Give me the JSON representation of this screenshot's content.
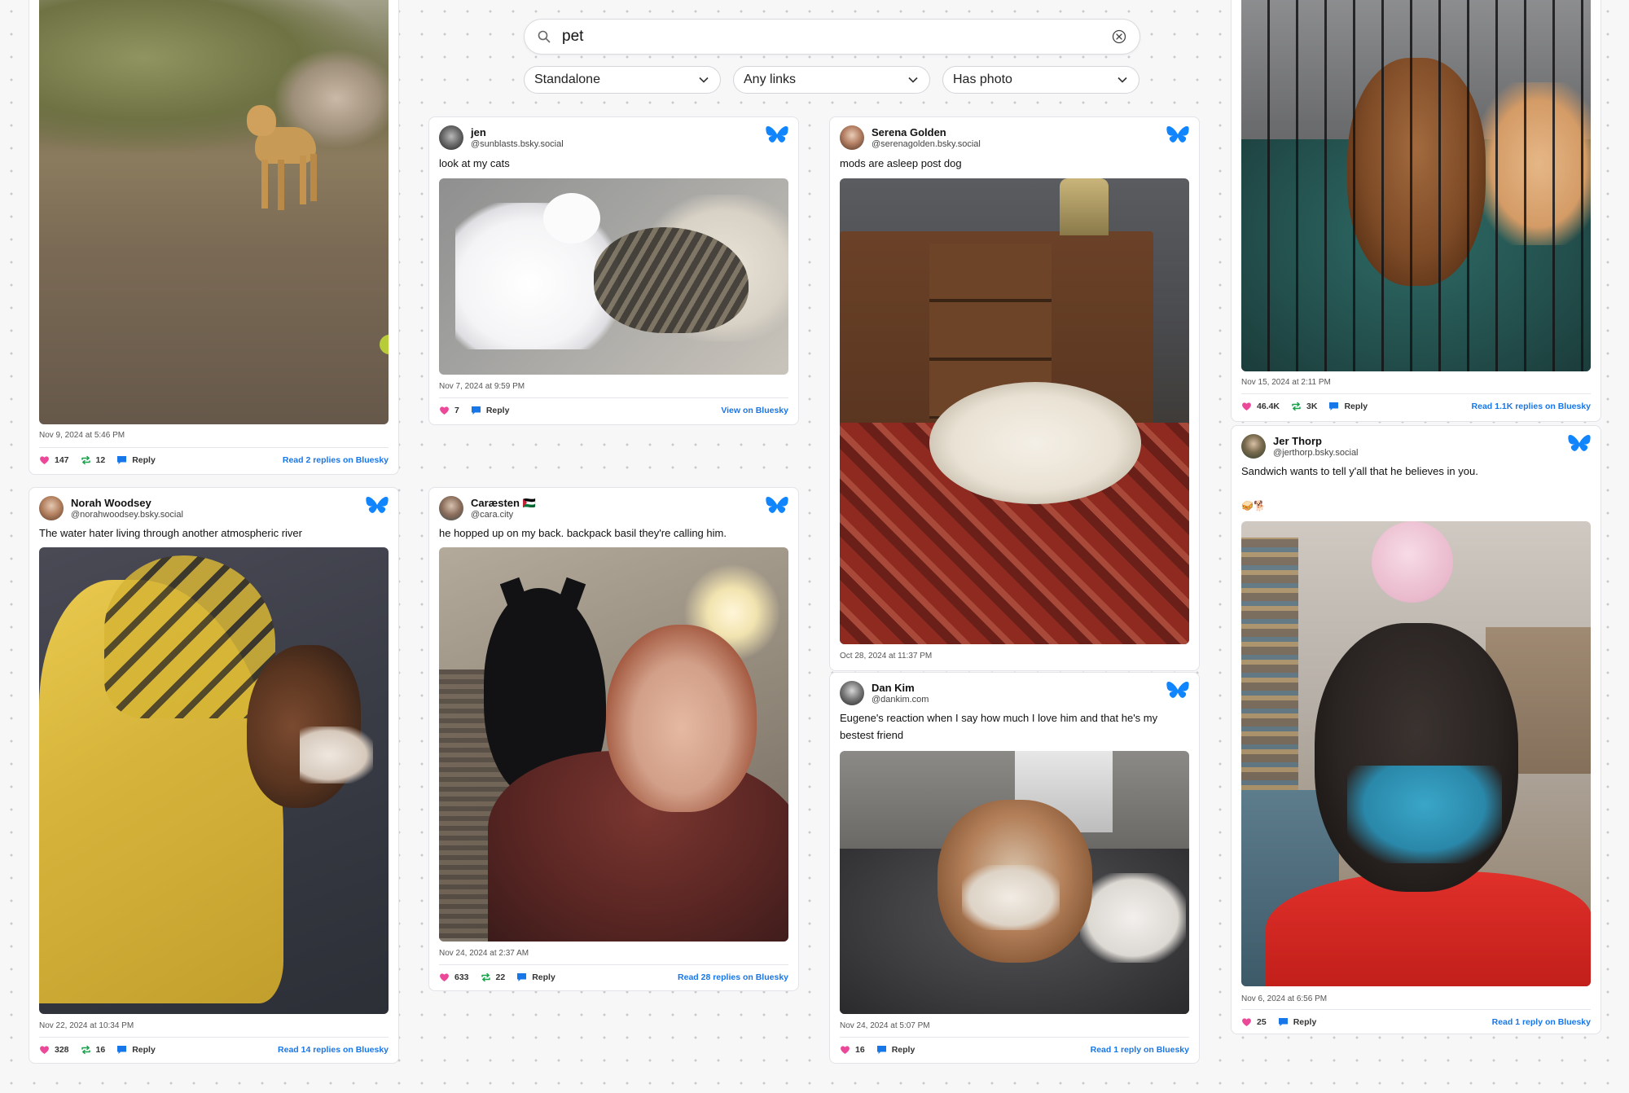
{
  "search": {
    "query": "pet"
  },
  "filters": [
    {
      "label": "Standalone"
    },
    {
      "label": "Any links"
    },
    {
      "label": "Has photo"
    }
  ],
  "posts": {
    "golden": {
      "date": "Nov 9, 2024 at 5:46 PM",
      "likes": "147",
      "reposts": "12",
      "reply": "Reply",
      "link": "Read 2 replies on Bluesky"
    },
    "jen": {
      "name": "jen",
      "handle": "@sunblasts.bsky.social",
      "text": "look at my cats",
      "date": "Nov 7, 2024 at 9:59 PM",
      "likes": "7",
      "reply": "Reply",
      "link": "View on Bluesky"
    },
    "serena": {
      "name": "Serena Golden",
      "handle": "@serenagolden.bsky.social",
      "text": "mods are asleep post dog",
      "date": "Oct 28, 2024 at 11:37 PM"
    },
    "dachshund": {
      "date": "Nov 15, 2024 at 2:11 PM",
      "likes": "46.4K",
      "reposts": "3K",
      "reply": "Reply",
      "link": "Read 1.1K replies on Bluesky"
    },
    "norah": {
      "name": "Norah Woodsey",
      "handle": "@norahwoodsey.bsky.social",
      "text": "The water hater living through another atmospheric river",
      "date": "Nov 22, 2024 at 10:34 PM",
      "likes": "328",
      "reposts": "16",
      "reply": "Reply",
      "link": "Read 14 replies on Bluesky"
    },
    "caraesten": {
      "name": "Caræsten 🇵🇸",
      "handle": "@cara.city",
      "text": "he hopped up on my back. backpack basil they're calling him.",
      "date": "Nov 24, 2024 at 2:37 AM",
      "likes": "633",
      "reposts": "22",
      "reply": "Reply",
      "link": "Read 28 replies on Bluesky"
    },
    "dankim": {
      "name": "Dan Kim",
      "handle": "@dankim.com",
      "text": "Eugene's reaction when I say how much I love him and that he's my bestest friend",
      "date": "Nov 24, 2024 at 5:07 PM",
      "likes": "16",
      "reply": "Reply",
      "link": "Read 1 reply on Bluesky"
    },
    "jer": {
      "name": "Jer Thorp",
      "handle": "@jerthorp.bsky.social",
      "text": "Sandwich wants to tell y'all that he believes in you.",
      "emoji": "🥪🐕",
      "date": "Nov 6, 2024 at 6:56 PM",
      "likes": "25",
      "reply": "Reply",
      "link": "Read 1 reply on Bluesky"
    }
  },
  "icons": {
    "like": "heart-icon",
    "repost": "repost-icon",
    "reply": "reply-bubble-icon",
    "bluesky": "bluesky-butterfly-icon",
    "search": "search-icon",
    "clear": "clear-icon",
    "chevron": "chevron-down-icon"
  },
  "colors": {
    "like": "#ec4899",
    "repost": "#16a34a",
    "link": "#1877e8",
    "bluesky": "#1185fe"
  }
}
